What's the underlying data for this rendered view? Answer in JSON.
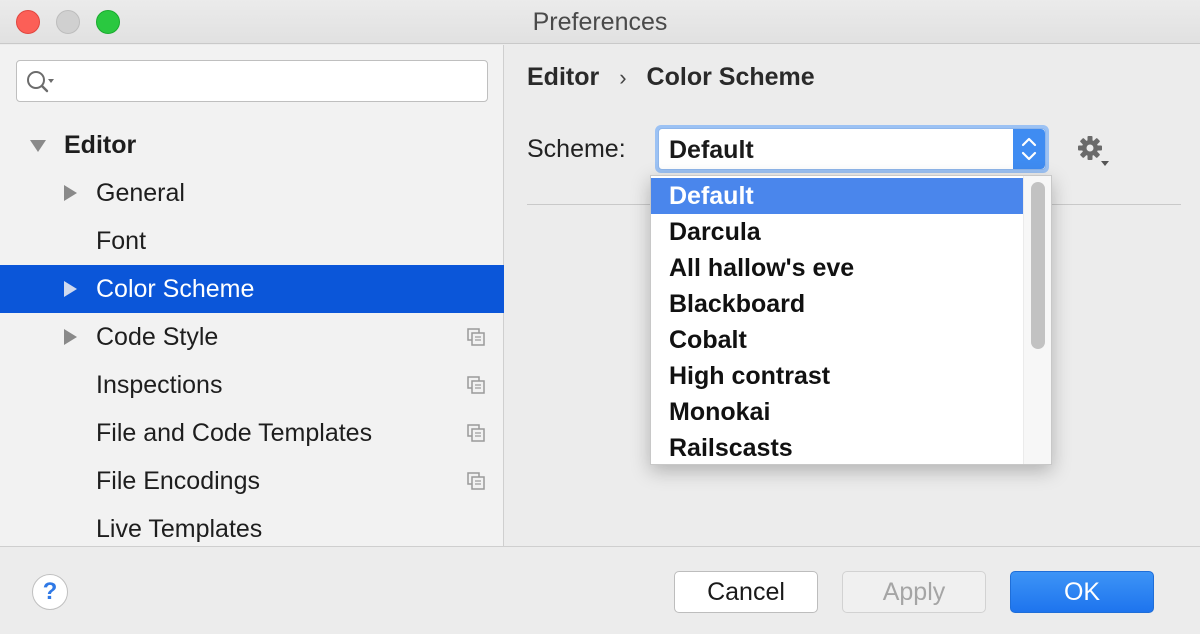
{
  "window": {
    "title": "Preferences"
  },
  "search": {
    "placeholder": "",
    "value": ""
  },
  "tree": [
    {
      "label": "Editor",
      "expanded": true,
      "bold": true,
      "selected": false
    },
    {
      "label": "General",
      "has_children": true,
      "selected": false
    },
    {
      "label": "Font",
      "has_children": false,
      "selected": false
    },
    {
      "label": "Color Scheme",
      "has_children": true,
      "selected": true
    },
    {
      "label": "Code Style",
      "has_children": true,
      "selected": false,
      "project_icon": true
    },
    {
      "label": "Inspections",
      "has_children": false,
      "selected": false,
      "project_icon": true
    },
    {
      "label": "File and Code Templates",
      "has_children": false,
      "selected": false,
      "project_icon": true
    },
    {
      "label": "File Encodings",
      "has_children": false,
      "selected": false,
      "project_icon": true
    },
    {
      "label": "Live Templates",
      "has_children": false,
      "selected": false
    }
  ],
  "breadcrumb": {
    "parent": "Editor",
    "separator": "›",
    "current": "Color Scheme"
  },
  "scheme": {
    "label": "Scheme:",
    "value": "Default"
  },
  "dropdown": {
    "options": [
      "Default",
      "Darcula",
      "All hallow's eve",
      "Blackboard",
      "Cobalt",
      "High contrast",
      "Monokai",
      "Railscasts"
    ],
    "selected": "Default"
  },
  "footer": {
    "help_label": "?",
    "cancel_label": "Cancel",
    "apply_label": "Apply",
    "ok_label": "OK"
  },
  "colors": {
    "selection": "#0b56d9",
    "dropdown_highlight": "#4a86ec",
    "primary_button": "#1e74ee"
  }
}
